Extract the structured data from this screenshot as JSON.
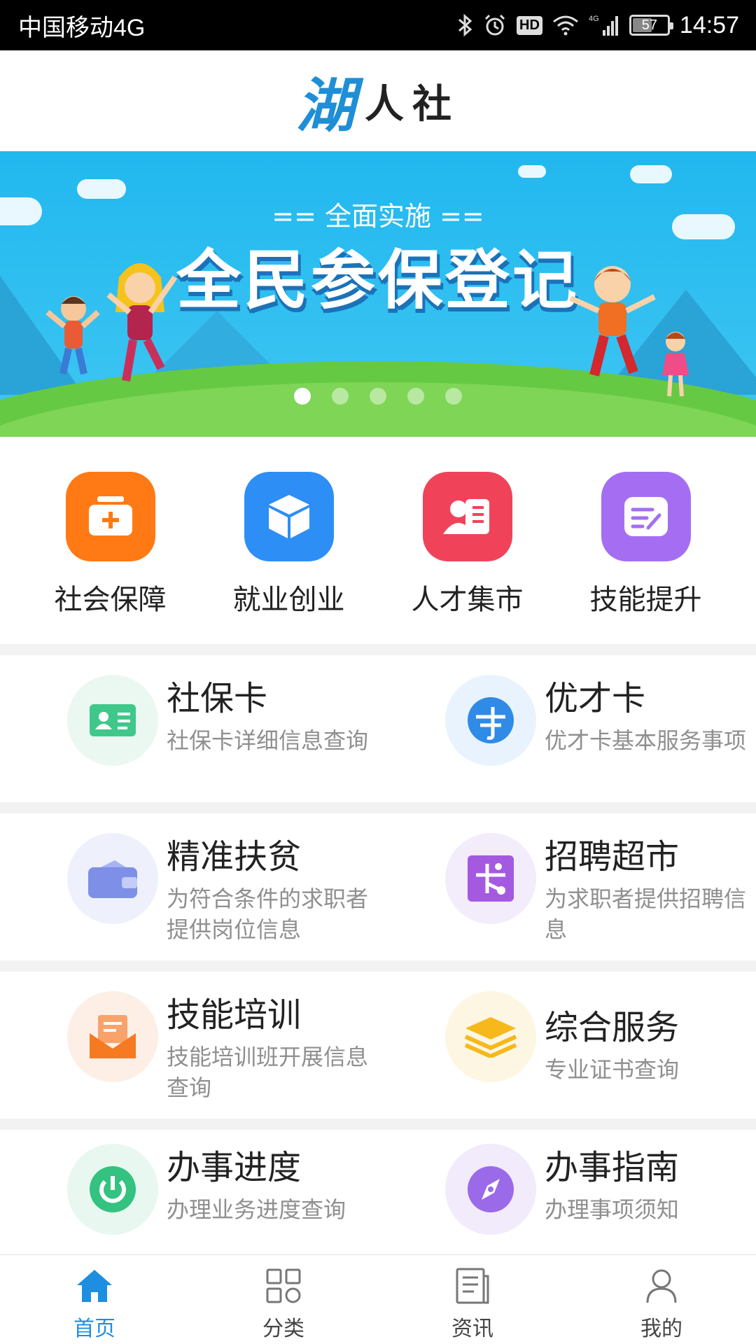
{
  "status_bar": {
    "carrier": "中国移动4G",
    "network_label": "4G",
    "hd_label": "HD",
    "battery": "57",
    "battery_level": 0.57,
    "time": "14:57"
  },
  "header": {
    "logo_mark": "湖",
    "title": "人社"
  },
  "banner": {
    "subtitle": "==  全面实施  ==",
    "title": "全民参保登记",
    "slide_count": 5,
    "active_slide": 1
  },
  "quick_categories": [
    {
      "label": "社会保障",
      "icon": "medical-kit-icon",
      "color": "#ff7a14"
    },
    {
      "label": "就业创业",
      "icon": "box-icon",
      "color": "#2d8ef6"
    },
    {
      "label": "人才集市",
      "icon": "id-person-icon",
      "color": "#f0435a"
    },
    {
      "label": "技能提升",
      "icon": "edit-note-icon",
      "color": "#a56ef2"
    }
  ],
  "services": [
    [
      {
        "title": "社保卡",
        "desc": "社保卡详细信息查询",
        "icon": "id-card-icon",
        "color": "#3fc88a",
        "bg": "#eaf8f1"
      },
      {
        "title": "优才卡",
        "desc": "优才卡基本服务事项",
        "icon": "talent-card-icon",
        "color": "#2f8be6",
        "bg": "#e8f3fd"
      }
    ],
    [
      {
        "title": "精准扶贫",
        "desc": "为符合条件的求职者提供岗位信息",
        "icon": "wallet-icon",
        "color": "#7d8fe6",
        "bg": "#eef0fc"
      },
      {
        "title": "招聘超市",
        "desc": "为求职者提供招聘信息",
        "icon": "network-icon",
        "color": "#a45ae0",
        "bg": "#f3ecfb"
      }
    ],
    [
      {
        "title": "技能培训",
        "desc": "技能培训班开展信息查询",
        "icon": "mail-document-icon",
        "color": "#f57a22",
        "bg": "#fdefe6"
      },
      {
        "title": "综合服务",
        "desc": "专业证书查询",
        "icon": "layers-icon",
        "color": "#f6b81b",
        "bg": "#fdf6e3"
      }
    ],
    [
      {
        "title": "办事进度",
        "desc": "办理业务进度查询",
        "icon": "power-progress-icon",
        "color": "#33c27f",
        "bg": "#e8f8f0"
      },
      {
        "title": "办事指南",
        "desc": "办理事项须知",
        "icon": "compass-icon",
        "color": "#9b6ae8",
        "bg": "#f1ebfb"
      }
    ]
  ],
  "bottom_nav": [
    {
      "label": "首页",
      "icon": "home-icon",
      "active": true
    },
    {
      "label": "分类",
      "icon": "grid-icon",
      "active": false
    },
    {
      "label": "资讯",
      "icon": "news-icon",
      "active": false
    },
    {
      "label": "我的",
      "icon": "user-icon",
      "active": false
    }
  ],
  "colors": {
    "accent": "#1e8fe0",
    "banner_sky": "#21b8ef",
    "banner_grass": "#66c944"
  }
}
